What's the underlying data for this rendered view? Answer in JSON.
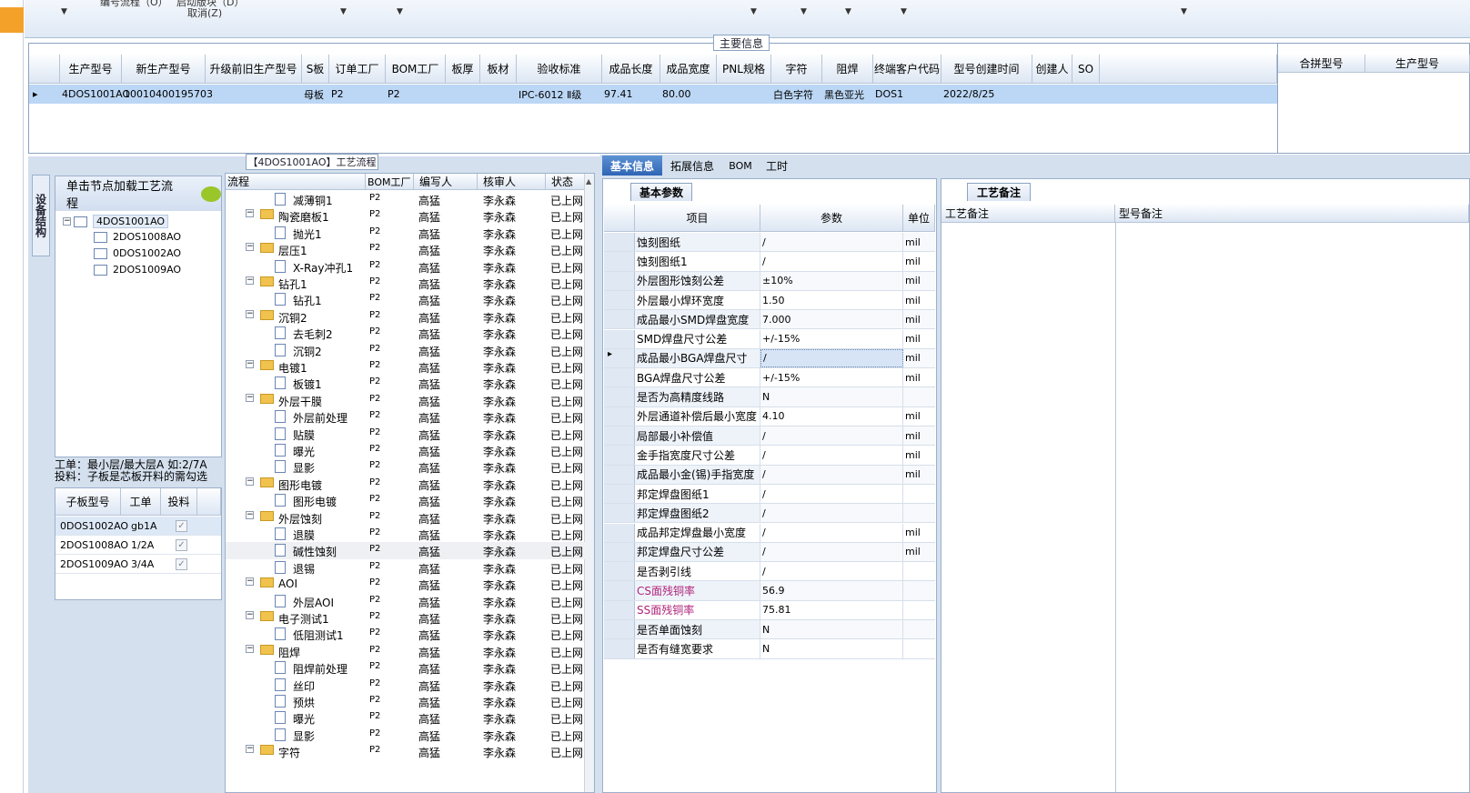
{
  "top": {
    "cut_text_1": "编号流程（O）",
    "cut_text_2": "启动版块（D）",
    "cancel": "取消(Z)"
  },
  "main_panel": {
    "title": "主要信息",
    "columns": [
      "生产型号",
      "新生产型号",
      "升级前旧生产型号",
      "S板",
      "订单工厂",
      "BOM工厂",
      "板厚",
      "板材",
      "验收标准",
      "成品长度",
      "成品宽度",
      "PNL规格",
      "字符",
      "阻焊",
      "终端客户代码",
      "型号创建时间",
      "创建人",
      "SO"
    ],
    "row": [
      "4DOS1001AO",
      "10010400195703",
      "",
      "母板",
      "P2",
      "P2",
      "",
      "",
      "IPC-6012 Ⅱ级",
      "97.41",
      "80.00",
      "",
      "白色字符",
      "黑色亚光",
      "DOS1",
      "2022/8/25",
      "",
      ""
    ],
    "right_columns": [
      "合拼型号",
      "生产型号"
    ]
  },
  "process_title": "【4DOS1001AO】工艺流程",
  "left_tree": {
    "vertical_tab": "设备结构",
    "header": "单击节点加载工艺流程",
    "nodes": [
      "4DOS1001AO",
      "2DOS1008AO",
      "0DOS1002AO",
      "2DOS1009AO"
    ]
  },
  "notes": {
    "line1": "工单：最小层/最大层A 如:2/7A",
    "line2": "投料：子板是芯板开料的需勾选"
  },
  "subgrid": {
    "columns": [
      "子板型号",
      "工单",
      "投料"
    ],
    "rows": [
      [
        "0DOS1002AO",
        "gb1A"
      ],
      [
        "2DOS1008AO",
        "1/2A"
      ],
      [
        "2DOS1009AO",
        "3/4A"
      ]
    ],
    "check_mark": "✓"
  },
  "process_grid": {
    "columns": [
      "流程",
      "BOM工厂",
      "编写人",
      "核审人",
      "状态"
    ],
    "rows": [
      {
        "name": "减薄铜1",
        "type": "file"
      },
      {
        "name": "陶瓷磨板1",
        "type": "folder"
      },
      {
        "name": "抛光1",
        "type": "file"
      },
      {
        "name": "层压1",
        "type": "folder"
      },
      {
        "name": "X-Ray冲孔1",
        "type": "file"
      },
      {
        "name": "钻孔1",
        "type": "folder"
      },
      {
        "name": "钻孔1",
        "type": "file"
      },
      {
        "name": "沉铜2",
        "type": "folder"
      },
      {
        "name": "去毛刺2",
        "type": "file"
      },
      {
        "name": "沉铜2",
        "type": "file"
      },
      {
        "name": "电镀1",
        "type": "folder"
      },
      {
        "name": "板镀1",
        "type": "file"
      },
      {
        "name": "外层干膜",
        "type": "folder"
      },
      {
        "name": "外层前处理",
        "type": "file"
      },
      {
        "name": "贴膜",
        "type": "file"
      },
      {
        "name": "曝光",
        "type": "file"
      },
      {
        "name": "显影",
        "type": "file"
      },
      {
        "name": "图形电镀",
        "type": "folder"
      },
      {
        "name": "图形电镀",
        "type": "file"
      },
      {
        "name": "外层蚀刻",
        "type": "folder"
      },
      {
        "name": "退膜",
        "type": "file"
      },
      {
        "name": "碱性蚀刻",
        "type": "file"
      },
      {
        "name": "退锡",
        "type": "file"
      },
      {
        "name": "AOI",
        "type": "folder"
      },
      {
        "name": "外层AOI",
        "type": "file"
      },
      {
        "name": "电子测试1",
        "type": "folder"
      },
      {
        "name": "低阻测试1",
        "type": "file"
      },
      {
        "name": "阻焊",
        "type": "folder"
      },
      {
        "name": "阻焊前处理",
        "type": "file"
      },
      {
        "name": "丝印",
        "type": "file"
      },
      {
        "name": "预烘",
        "type": "file"
      },
      {
        "name": "曝光",
        "type": "file"
      },
      {
        "name": "显影",
        "type": "file"
      },
      {
        "name": "字符",
        "type": "folder"
      }
    ],
    "bom": "P2",
    "writer": "高猛",
    "reviewer": "李永森",
    "status": "已上网"
  },
  "tabs": [
    "基本信息",
    "拓展信息",
    "BOM",
    "工时"
  ],
  "base_params": {
    "title": "基本参数",
    "columns": [
      "项目",
      "参数",
      "单位"
    ],
    "rows": [
      [
        "蚀刻图纸",
        "/",
        "mil"
      ],
      [
        "蚀刻图纸1",
        "/",
        "mil"
      ],
      [
        "外层图形蚀刻公差",
        "±10%",
        "mil"
      ],
      [
        "外层最小焊环宽度",
        "1.50",
        "mil"
      ],
      [
        "成品最小SMD焊盘宽度",
        "7.000",
        "mil"
      ],
      [
        "SMD焊盘尺寸公差",
        "+/-15%",
        "mil"
      ],
      [
        "成品最小BGA焊盘尺寸",
        "/",
        "mil"
      ],
      [
        "BGA焊盘尺寸公差",
        "+/-15%",
        "mil"
      ],
      [
        "是否为高精度线路",
        "N",
        ""
      ],
      [
        "外层通道补偿后最小宽度",
        "4.10",
        "mil"
      ],
      [
        "局部最小补偿值",
        "/",
        "mil"
      ],
      [
        "金手指宽度尺寸公差",
        "/",
        "mil"
      ],
      [
        "成品最小金(锡)手指宽度",
        "/",
        "mil"
      ],
      [
        "邦定焊盘图纸1",
        "/",
        ""
      ],
      [
        "邦定焊盘图纸2",
        "/",
        ""
      ],
      [
        "成品邦定焊盘最小宽度",
        "/",
        "mil"
      ],
      [
        "邦定焊盘尺寸公差",
        "/",
        "mil"
      ],
      [
        "是否剥引线",
        "/",
        ""
      ],
      [
        "CS面残铜率",
        "56.9",
        ""
      ],
      [
        "SS面残铜率",
        "75.81",
        ""
      ],
      [
        "是否单面蚀刻",
        "N",
        ""
      ],
      [
        "是否有缝宽要求",
        "N",
        ""
      ]
    ],
    "highlight_color": "#b0247a"
  },
  "process_notes": {
    "title": "工艺备注",
    "columns": [
      "工艺备注",
      "型号备注"
    ]
  }
}
